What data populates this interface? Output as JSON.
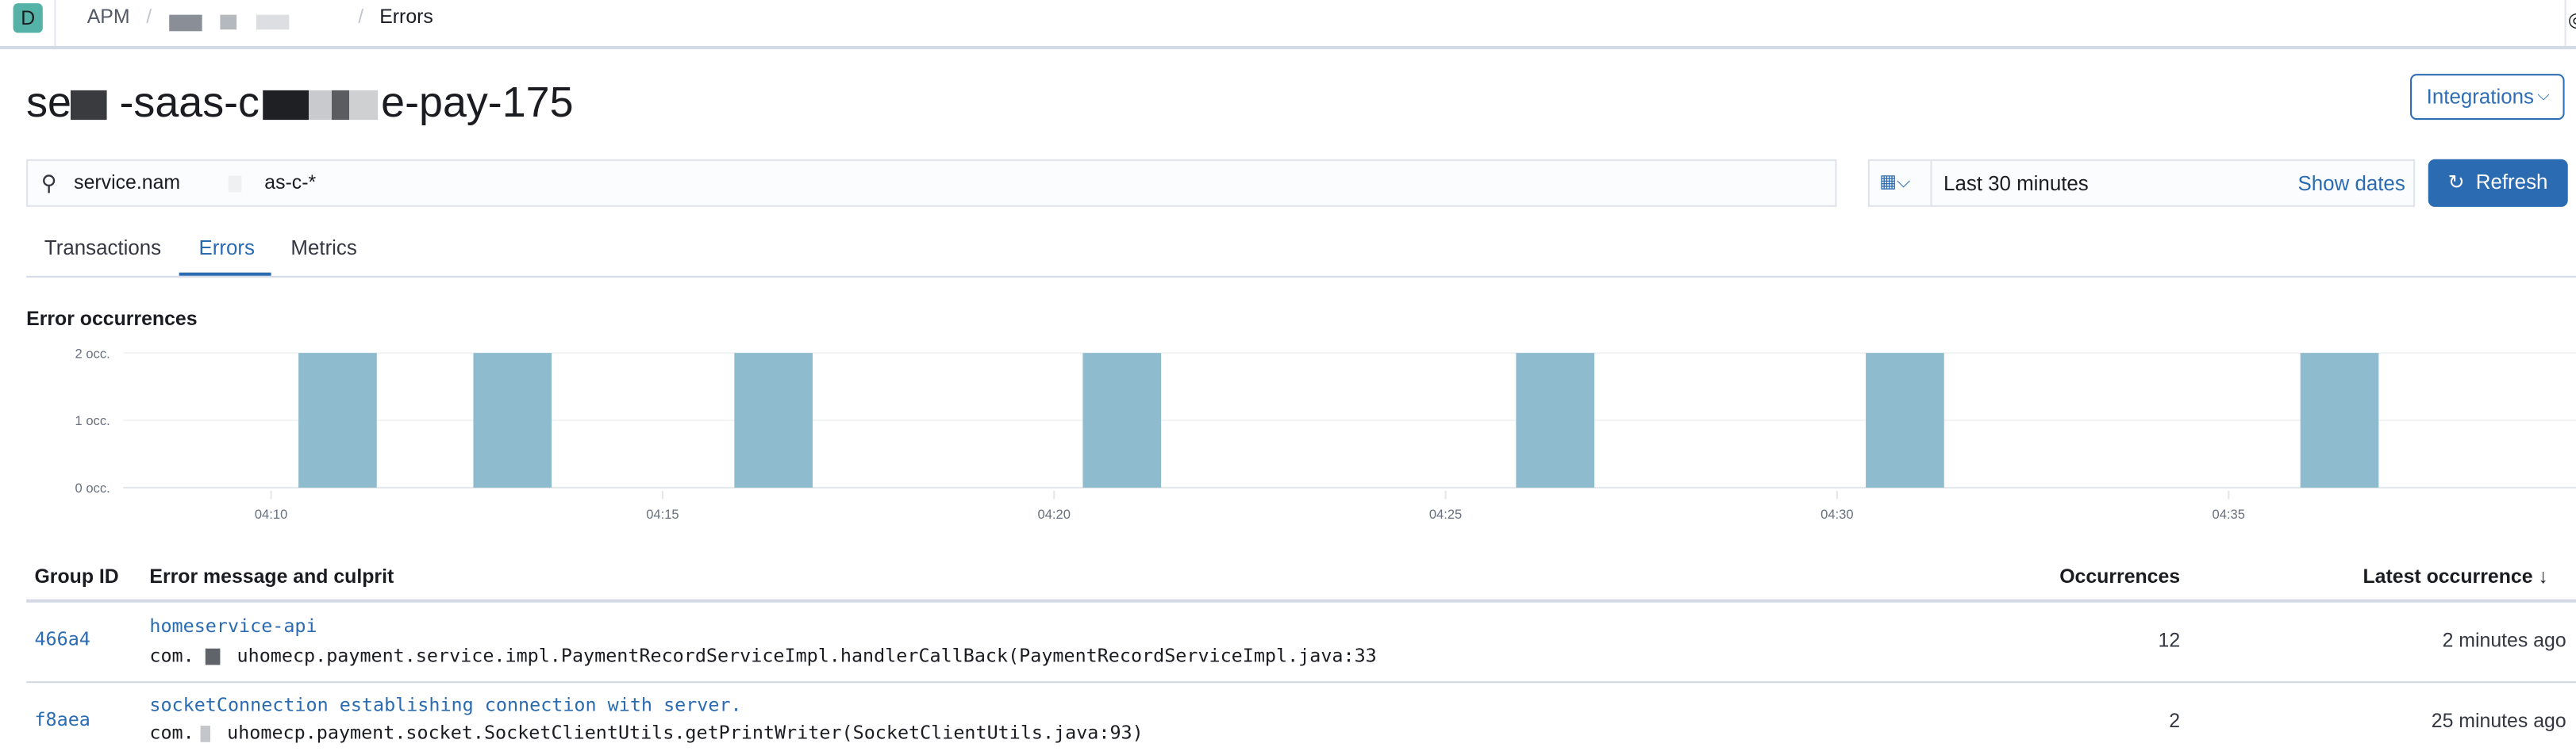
{
  "header": {
    "avatar_letter": "D",
    "breadcrumbs": [
      "APM",
      "Errors"
    ],
    "accent_color": "#2a6bb2"
  },
  "page": {
    "title_parts": [
      "se",
      " -saas-c",
      "e-pay-175"
    ],
    "integrations_label": "Integrations"
  },
  "search": {
    "value_parts": [
      "service.nam",
      "as-c-*"
    ]
  },
  "date_picker": {
    "range_label": "Last 30 minutes",
    "show_dates_label": "Show dates",
    "refresh_label": "Refresh"
  },
  "tabs": [
    {
      "label": "Transactions",
      "active": false
    },
    {
      "label": "Errors",
      "active": true
    },
    {
      "label": "Metrics",
      "active": false
    }
  ],
  "chart_data": {
    "type": "bar",
    "title": "Error occurrences",
    "bar_color": "#8fbbce",
    "bucket_minutes": 1,
    "x_ticks": [
      "04:10",
      "04:15",
      "04:20",
      "04:25",
      "04:30",
      "04:35"
    ],
    "y_ticks": [
      "0 occ.",
      "1 occ.",
      "2 occ."
    ],
    "ylim": [
      0,
      2
    ],
    "grid": true,
    "bars": [
      {
        "start": "04:10:21",
        "value": 2
      },
      {
        "start": "04:12:35",
        "value": 2
      },
      {
        "start": "04:15:55",
        "value": 2
      },
      {
        "start": "04:20:22",
        "value": 2
      },
      {
        "start": "04:25:54",
        "value": 2
      },
      {
        "start": "04:30:22",
        "value": 2
      },
      {
        "start": "04:35:55",
        "value": 2
      }
    ]
  },
  "table": {
    "headers": {
      "group_id": "Group ID",
      "message": "Error message and culprit",
      "occurrences": "Occurrences",
      "latest": "Latest occurrence",
      "sort_icon": "arrow-down-icon"
    },
    "rows": [
      {
        "group_id": "466a4",
        "message": "homeservice-api",
        "culprit_prefix": "com.",
        "culprit": "uhomecp.payment.service.impl.PaymentRecordServiceImpl.handlerCallBack(PaymentRecordServiceImpl.java:33",
        "occurrences": "12",
        "latest": "2 minutes ago"
      },
      {
        "group_id": "f8aea",
        "message": "socketConnection establishing connection with server.",
        "culprit_prefix": "com.",
        "culprit": "uhomecp.payment.socket.SocketClientUtils.getPrintWriter(SocketClientUtils.java:93)",
        "occurrences": "2",
        "latest": "25 minutes ago"
      }
    ]
  }
}
